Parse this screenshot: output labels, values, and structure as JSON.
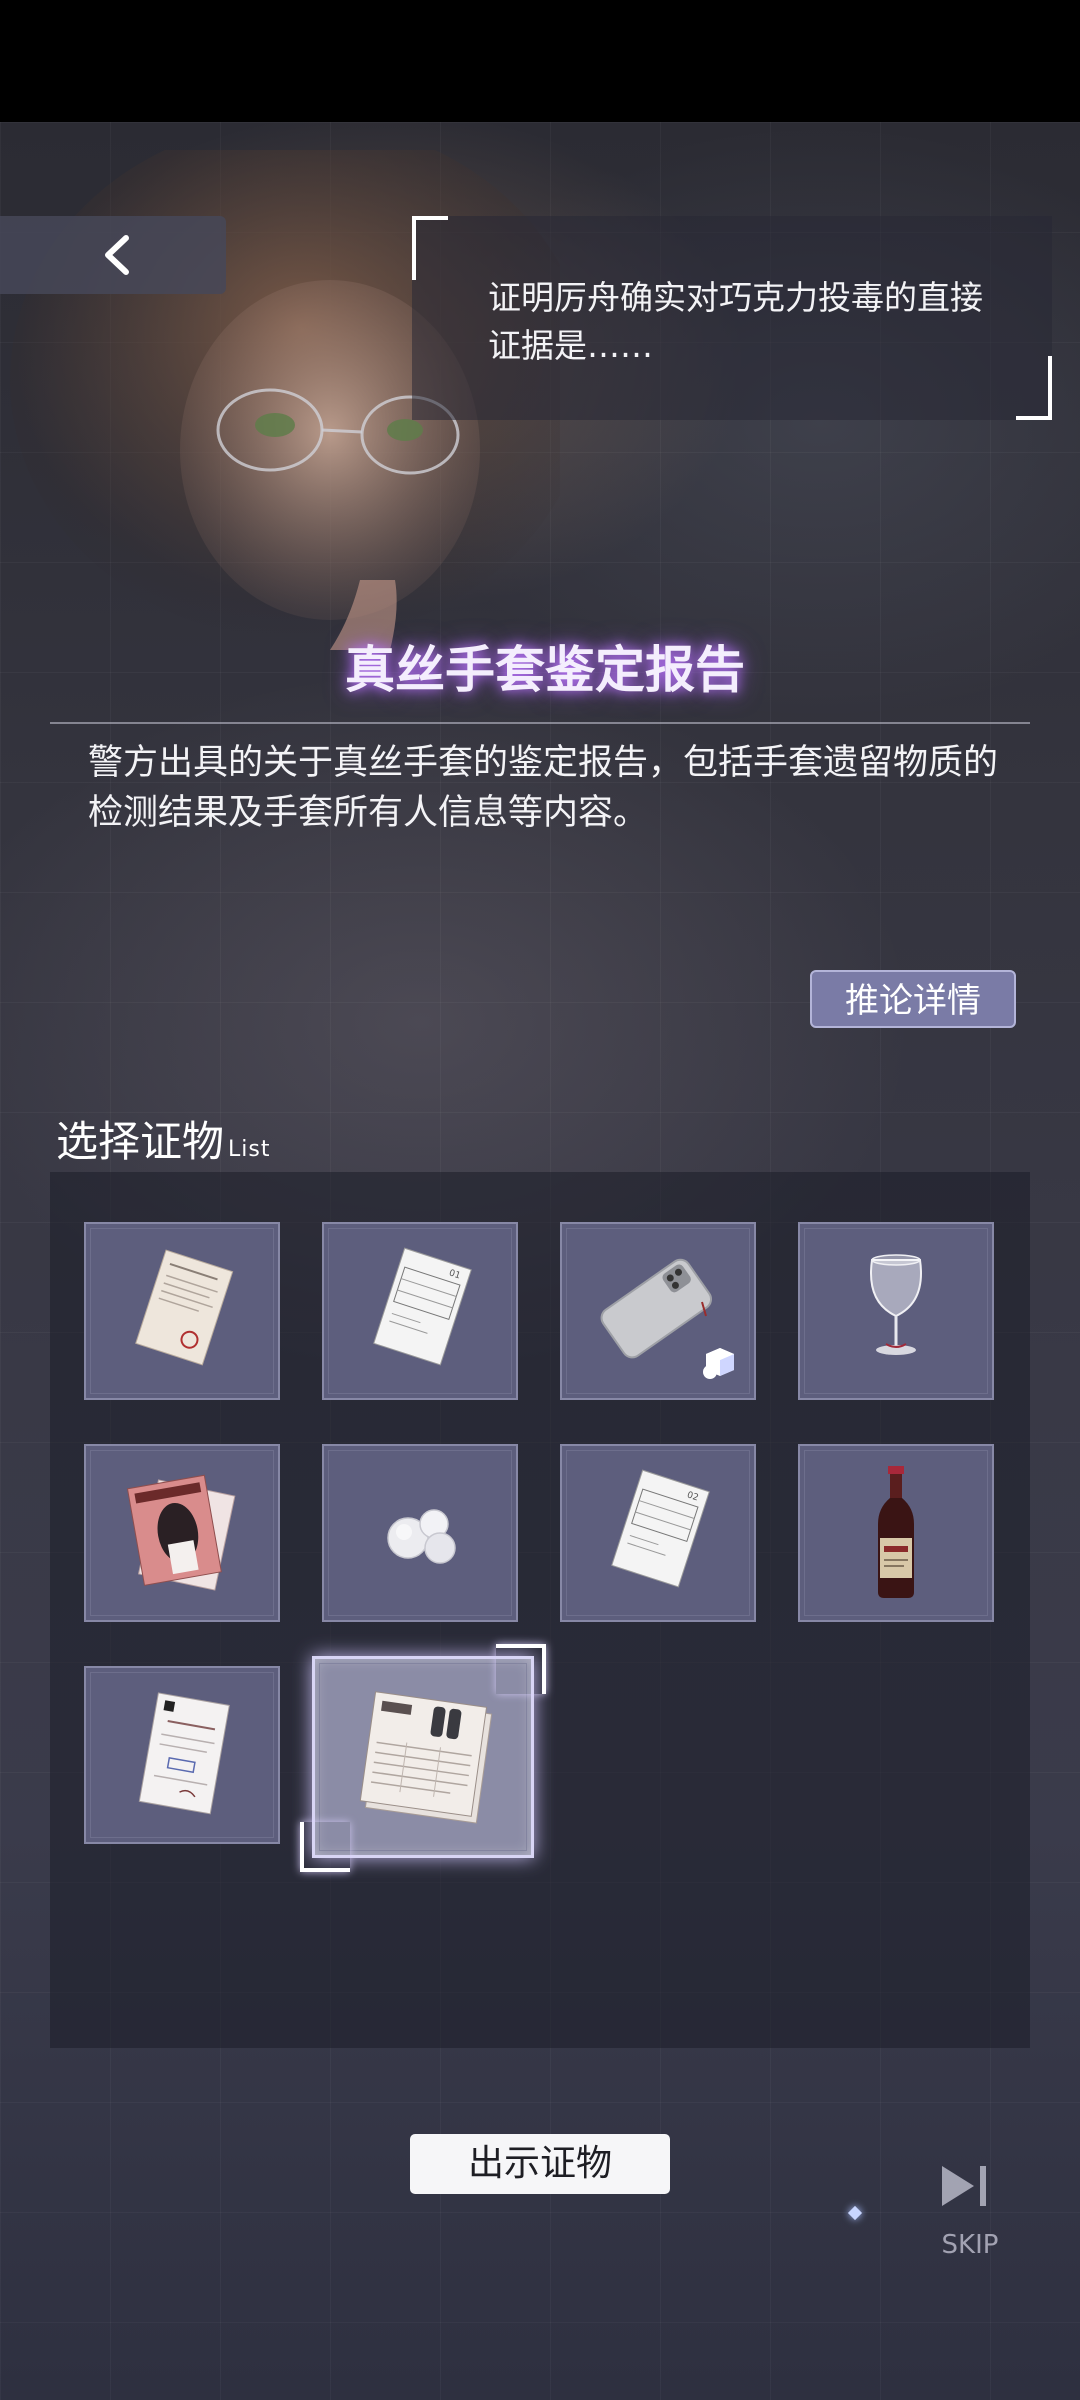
{
  "prompt": {
    "text": "证明厉舟确实对巧克力投毒的直接证据是……"
  },
  "evidence": {
    "title": "真丝手套鉴定报告",
    "description": "警方出具的关于真丝手套的鉴定报告，包括手套遗留物质的检测结果及手套所有人信息等内容。",
    "details_label": "推论详情"
  },
  "list_section": {
    "title": "选择证物",
    "subtitle": "List"
  },
  "items": [
    {
      "icon": "document-report-icon",
      "selected": false
    },
    {
      "icon": "numbered-document-icon",
      "selected": false
    },
    {
      "icon": "smartphone-icon",
      "selected": false,
      "badge": "3d-view-icon"
    },
    {
      "icon": "wine-glass-icon",
      "selected": false
    },
    {
      "icon": "magazine-icon",
      "selected": false
    },
    {
      "icon": "cotton-balls-icon",
      "selected": false
    },
    {
      "icon": "numbered-document-icon",
      "selected": false
    },
    {
      "icon": "wine-bottle-icon",
      "selected": false
    },
    {
      "icon": "certificate-document-icon",
      "selected": false
    },
    {
      "icon": "glove-report-icon",
      "selected": true
    }
  ],
  "actions": {
    "present_label": "出示证物",
    "skip_label": "SKIP"
  },
  "colors": {
    "slot": "#5d5e7d",
    "accent_glow": "#b078ff",
    "button_bg": "#7a7ba6"
  }
}
